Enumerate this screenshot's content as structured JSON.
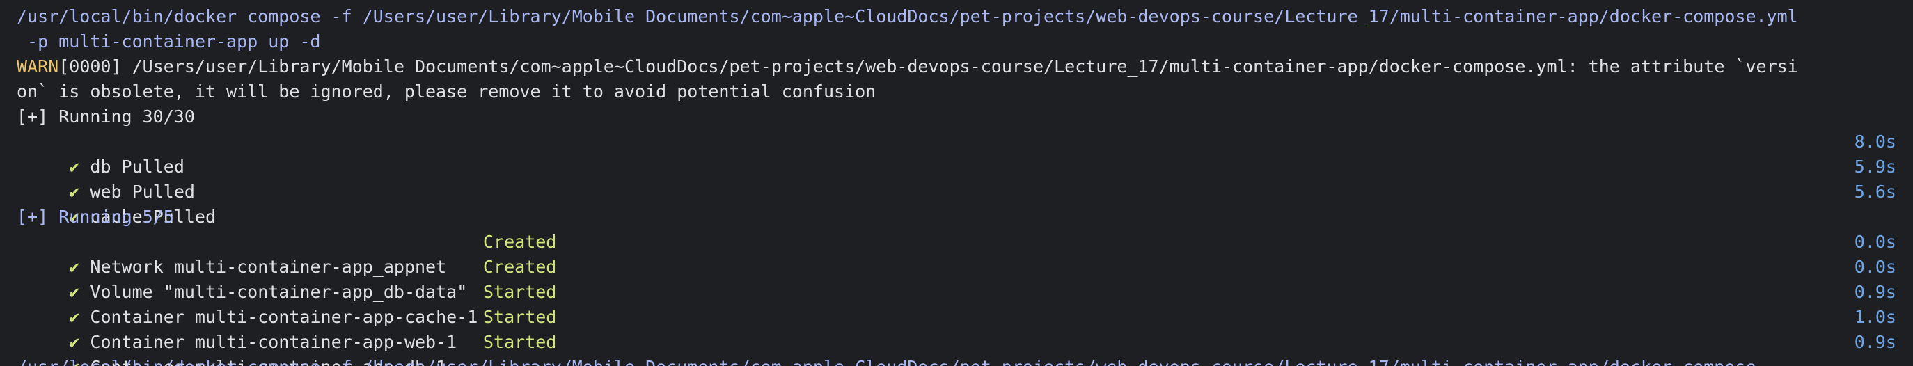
{
  "colors": {
    "background": "#1e1f22",
    "command": "#a9b7f5",
    "warn": "#ebc46c",
    "check": "#d3e37d",
    "time": "#6ea5e6",
    "text": "#dfe1e5"
  },
  "command": {
    "line1": "/usr/local/bin/docker compose -f /Users/user/Library/Mobile Documents/com~apple~CloudDocs/pet-projects/web-devops-course/Lecture_17/multi-container-app/docker-compose.yml",
    "line2": " -p multi-container-app up -d"
  },
  "warning": {
    "tag": "WARN",
    "line1_rest": "[0000] /Users/user/Library/Mobile Documents/com~apple~CloudDocs/pet-projects/web-devops-course/Lecture_17/multi-container-app/docker-compose.yml: the attribute `versi",
    "line2": "on` is obsolete, it will be ignored, please remove it to avoid potential confusion"
  },
  "pull_section": {
    "header": "[+] Running 30/30",
    "items": [
      {
        "check": "✔",
        "name": "db Pulled",
        "time": "8.0s"
      },
      {
        "check": "✔",
        "name": "web Pulled",
        "time": "5.9s"
      },
      {
        "check": "✔",
        "name": "cache Pulled",
        "time": "5.6s"
      }
    ]
  },
  "create_section": {
    "header": "[+] Running 5/5",
    "items": [
      {
        "check": "✔",
        "name": "Network multi-container-app_appnet",
        "status": "Created",
        "time": "0.0s"
      },
      {
        "check": "✔",
        "name": "Volume \"multi-container-app_db-data\"",
        "status": "Created",
        "time": "0.0s"
      },
      {
        "check": "✔",
        "name": "Container multi-container-app-cache-1",
        "status": "Started",
        "time": "0.9s"
      },
      {
        "check": "✔",
        "name": "Container multi-container-app-web-1",
        "status": "Started",
        "time": "1.0s"
      },
      {
        "check": "✔",
        "name": "Container multi-container-app-db-1",
        "status": "Started",
        "time": "0.9s"
      }
    ]
  },
  "next_command": {
    "line1": "/usr/local/bin/docker compose -f /Users/user/Library/Mobile Documents/com~apple~CloudDocs/pet-projects/web-devops-course/Lecture_17/multi-container-app/docker-compose"
  }
}
